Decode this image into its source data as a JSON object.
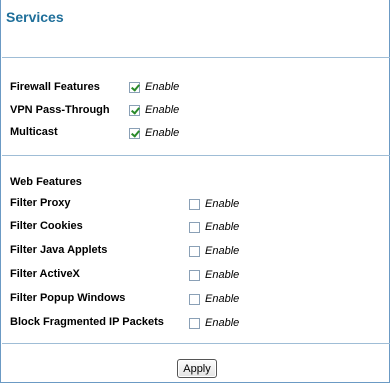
{
  "title": "Services",
  "section1": [
    {
      "label": "Firewall Features",
      "enable": "Enable",
      "checked": true
    },
    {
      "label": "VPN Pass-Through",
      "enable": "Enable",
      "checked": true
    },
    {
      "label": "Multicast",
      "enable": "Enable",
      "checked": true
    }
  ],
  "web_features": {
    "heading": "Web Features",
    "items": [
      {
        "label": "Filter Proxy",
        "enable": "Enable",
        "checked": false
      },
      {
        "label": "Filter Cookies",
        "enable": "Enable",
        "checked": false
      },
      {
        "label": "Filter Java Applets",
        "enable": "Enable",
        "checked": false
      },
      {
        "label": "Filter ActiveX",
        "enable": "Enable",
        "checked": false
      },
      {
        "label": "Filter Popup Windows",
        "enable": "Enable",
        "checked": false
      },
      {
        "label": "Block Fragmented IP Packets",
        "enable": "Enable",
        "checked": false
      }
    ]
  },
  "apply_label": "Apply",
  "colors": {
    "title": "#1f6f9a",
    "rule": "#9fbdd6",
    "check": "#2a8a2a"
  }
}
